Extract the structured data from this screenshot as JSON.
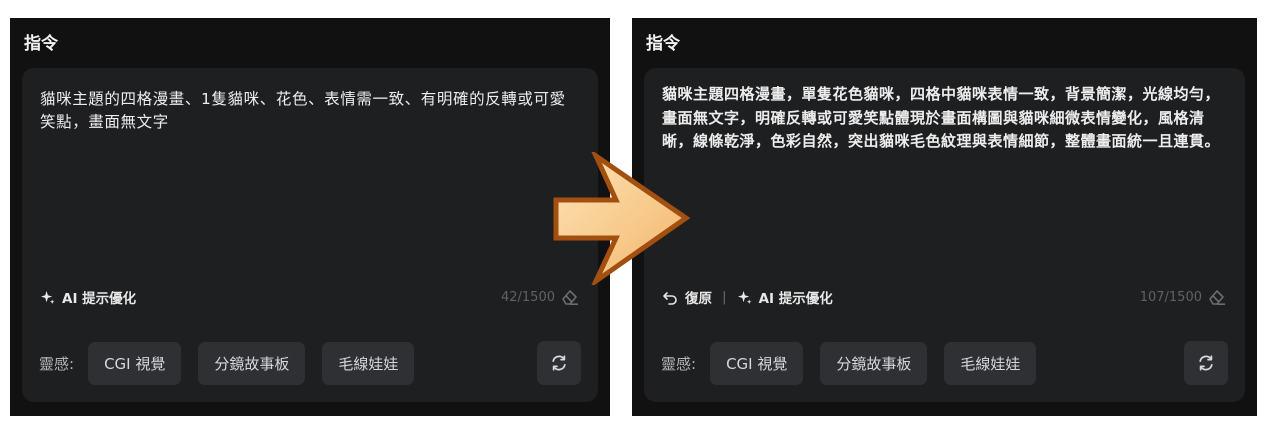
{
  "before": {
    "title": "指令",
    "prompt": "貓咪主題的四格漫畫、1隻貓咪、花色、表情需一致、有明確的反轉或可愛笑點，畫面無文字",
    "ai_optimize_label": "AI 提示優化",
    "counter": "42/1500",
    "inspiration_label": "靈感:",
    "chips": [
      "CGI 視覺",
      "分鏡故事板",
      "毛線娃娃"
    ]
  },
  "after": {
    "title": "指令",
    "prompt": "貓咪主題四格漫畫，單隻花色貓咪，四格中貓咪表情一致，背景簡潔，光線均勻，畫面無文字，明確反轉或可愛笑點體現於畫面構圖與貓咪細微表情變化，風格清晰，線條乾淨，色彩自然，突出貓咪毛色紋理與表情細節，整體畫面統一且連貫。",
    "restore_label": "復原",
    "separator": "|",
    "ai_optimize_label": "AI 提示優化",
    "counter": "107/1500",
    "inspiration_label": "靈感:",
    "chips": [
      "CGI 視覺",
      "分鏡故事板",
      "毛線娃娃"
    ]
  },
  "icons": {
    "sparkle": "sparkle-icon",
    "eraser": "eraser-icon",
    "undo": "undo-icon",
    "refresh": "refresh-icon",
    "arrow": "right-arrow-icon"
  },
  "colors": {
    "panel_bg": "#111112",
    "card_bg": "#1e1f21",
    "chip_bg": "#2e3034",
    "arrow_fill": "#f7c98a",
    "arrow_stroke": "#a34f10"
  }
}
